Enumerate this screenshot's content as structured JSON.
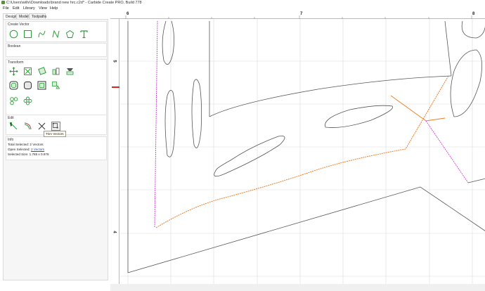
{
  "window": {
    "title": "C:\\Users\\willv\\Downloads\\brand new hrc.c2d* - Carbide Create PRO, Build 778"
  },
  "menu": [
    "File",
    "Edit",
    "Library",
    "View",
    "Help"
  ],
  "tabs": [
    "Design",
    "Model",
    "Toolpaths"
  ],
  "sections": {
    "create_vector": "Create Vector",
    "boolean": "Boolean",
    "transform": "Transform",
    "edit": "Edit",
    "info": "Info"
  },
  "info": {
    "total_selected_label": "Total Selected:",
    "total_selected_value": "2 Vectors",
    "open_selected_label": "Open Selected:",
    "open_selected_value": "2 Vectors",
    "selected_size_label": "Selected Size:",
    "selected_size_value": "1.785 x 0.878"
  },
  "tooltip": "Trim Vectors",
  "ruler": {
    "h_labels": [
      "6",
      "7",
      "8"
    ],
    "v_labels": [
      "5",
      "4"
    ]
  },
  "colors": {
    "accent_green": "#2e9c3a",
    "selected_orange": "#f07a1e",
    "selected_magenta": "#d63ce0",
    "vector_gray": "#555555",
    "grid": "#d9d9d9",
    "marker_red": "#e02020"
  },
  "icons": {
    "create": [
      "circle-icon",
      "rectangle-icon",
      "curve-icon",
      "polyline-icon",
      "polygon-icon",
      "text-icon"
    ],
    "transform": [
      "move-icon",
      "scale-icon",
      "rotate-icon",
      "align-icon",
      "mirror-icon",
      "offset-icon",
      "fillet-icon",
      "group-icon",
      "ungroup-icon",
      "array-icon",
      "circular-array-icon"
    ],
    "edit": [
      "node-edit-icon",
      "join-icon",
      "trim-icon",
      "trim-vectors-icon"
    ]
  }
}
